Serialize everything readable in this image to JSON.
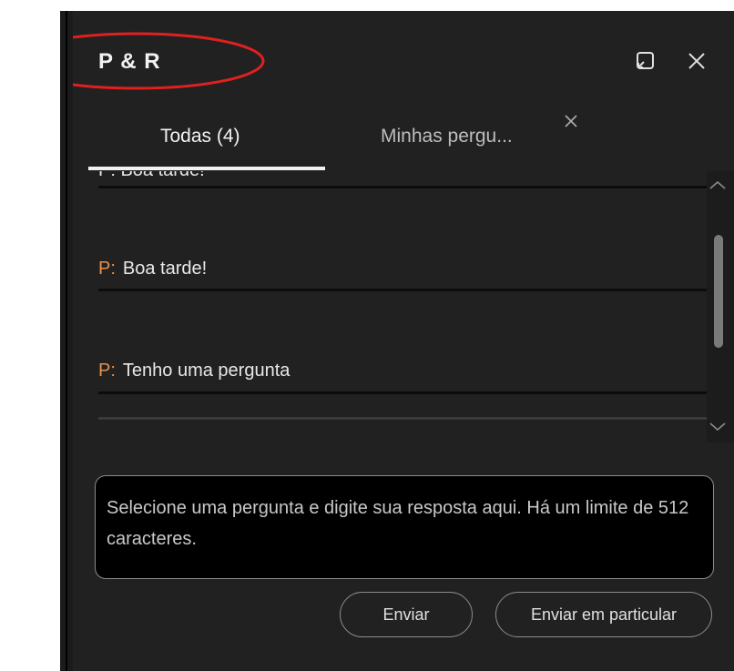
{
  "header": {
    "title": "P & R",
    "icons": [
      "popout-icon",
      "close-icon"
    ]
  },
  "tabs": [
    {
      "label": "Todas (4)",
      "active": true
    },
    {
      "label": "Minhas pergu...",
      "active": false
    }
  ],
  "questions": {
    "partial_text": "P: Boa tarde!",
    "items": [
      {
        "prefix": "P:",
        "text": "Boa tarde!"
      },
      {
        "prefix": "P:",
        "text": "Tenho uma pergunta"
      }
    ]
  },
  "answer": {
    "placeholder": "Selecione uma pergunta e digite sua resposta aqui. Há um limite de 512 caracteres."
  },
  "actions": {
    "send_label": "Enviar",
    "send_private_label": "Enviar em particular"
  },
  "colors": {
    "panel_bg": "#212121",
    "question_prefix": "#e8904a",
    "annotation": "#e02020"
  }
}
